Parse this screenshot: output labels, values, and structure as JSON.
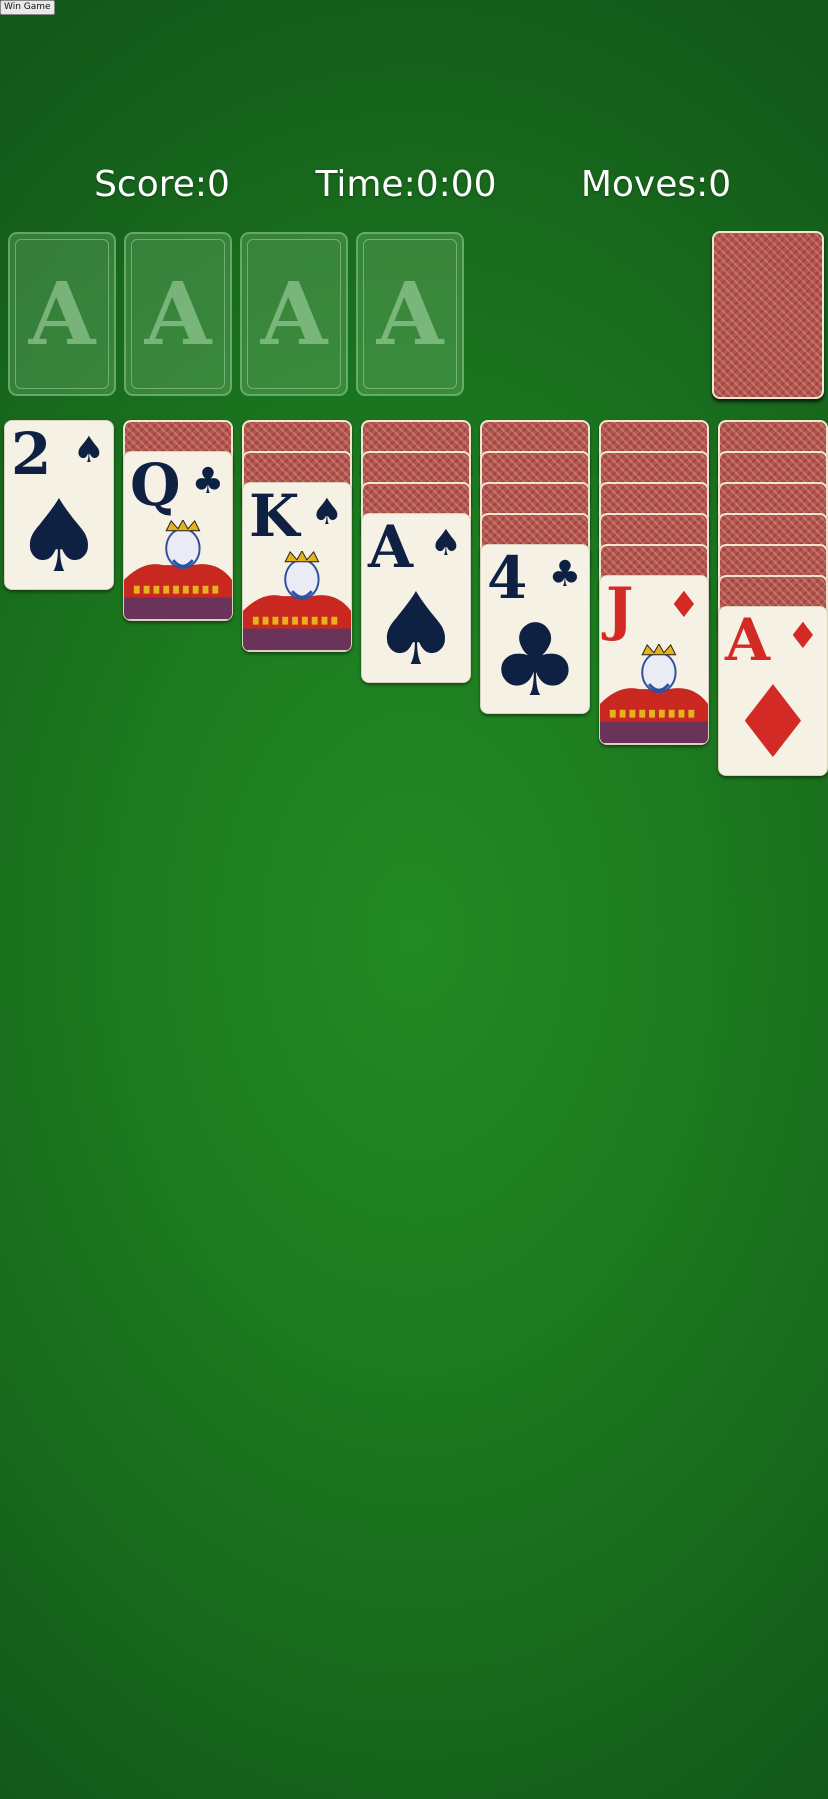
{
  "debug": {
    "win_label": "Win Game"
  },
  "stats": {
    "score_label": "Score:",
    "score": "0",
    "time_label": "Time:",
    "time": "0:00",
    "moves_label": "Moves:",
    "moves": "0"
  },
  "foundations": [
    {
      "placeholder": "A"
    },
    {
      "placeholder": "A"
    },
    {
      "placeholder": "A"
    },
    {
      "placeholder": "A"
    }
  ],
  "stock": {
    "state": "face-down"
  },
  "tableau": [
    {
      "hidden": 0,
      "top": {
        "rank": "2",
        "suit": "♠",
        "color": "black"
      }
    },
    {
      "hidden": 1,
      "top": {
        "rank": "Q",
        "suit": "♣",
        "color": "black"
      }
    },
    {
      "hidden": 2,
      "top": {
        "rank": "K",
        "suit": "♠",
        "color": "black"
      }
    },
    {
      "hidden": 3,
      "top": {
        "rank": "A",
        "suit": "♠",
        "color": "black"
      }
    },
    {
      "hidden": 4,
      "top": {
        "rank": "4",
        "suit": "♣",
        "color": "black"
      }
    },
    {
      "hidden": 5,
      "top": {
        "rank": "J",
        "suit": "♦",
        "color": "red"
      }
    },
    {
      "hidden": 6,
      "top": {
        "rank": "A",
        "suit": "♦",
        "color": "red"
      }
    }
  ],
  "colors": {
    "felt": "#1c7a1f",
    "card_face": "#f5f1e4",
    "card_back": "#b5554d",
    "suit_black": "#0f2143",
    "suit_red": "#d42a26"
  }
}
